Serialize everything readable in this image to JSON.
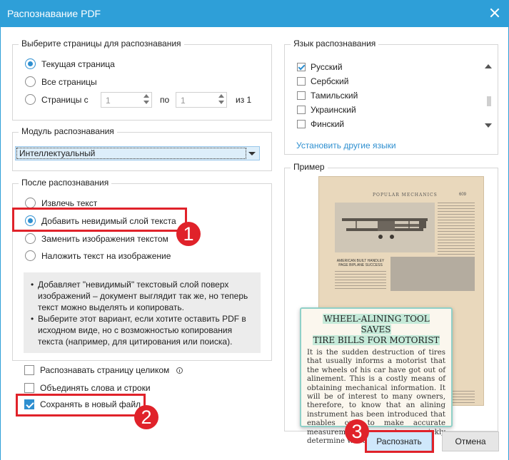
{
  "window": {
    "title": "Распознавание PDF"
  },
  "pages": {
    "legend": "Выберите страницы для распознавания",
    "current_label": "Текущая страница",
    "all_label": "Все страницы",
    "range_label": "Страницы с",
    "from_value": "1",
    "to_label": "по",
    "to_value": "1",
    "of_label": "из 1"
  },
  "module": {
    "legend": "Модуль распознавания",
    "selected": "Интеллектуальный"
  },
  "after": {
    "legend": "После распознавания",
    "options": [
      "Извлечь текст",
      "Добавить невидимый слой текста",
      "Заменить изображения текстом",
      "Наложить текст на изображение"
    ],
    "info": [
      "Добавляет \"невидимый\" текстовый слой поверх изображений – документ выглядит так же, но теперь текст можно выделять и копировать.",
      "Выберите этот вариант, если хотите оставить PDF в исходном виде, но с возможностью копирования текста (например, для цитирования или поиска)."
    ]
  },
  "options": {
    "whole_page": "Распознавать страницу целиком",
    "merge_words": "Объединять слова и строки",
    "save_new": "Сохранять в новый файл"
  },
  "language": {
    "legend": "Язык распознавания",
    "items": [
      {
        "label": "Русский",
        "checked": true
      },
      {
        "label": "Сербский",
        "checked": false
      },
      {
        "label": "Тамильский",
        "checked": false
      },
      {
        "label": "Украинский",
        "checked": false
      },
      {
        "label": "Финский",
        "checked": false
      }
    ],
    "install_link": "Установить другие языки"
  },
  "example": {
    "legend": "Пример",
    "running_head": "POPULAR MECHANICS",
    "page_number": "609",
    "caption": "AMERICAN BUILT HANDLEY PAGE BIPLANE SUCCESS",
    "zoom_head_1": "WHEEL-ALINING TOOL SAVES",
    "zoom_head_2": "TIRE BILLS FOR MOTORIST",
    "zoom_text": "It is the sudden destruction of tires that usually informs a motorist that the wheels of his car have got out of alinement. This is a costly means of obtaining mechanical information. It will be of interest to many owners, therefore, to know that an alining instrument has been introduced that enables one to make accurate measurements and quickly determine whether"
  },
  "buttons": {
    "recognize": "Распознать",
    "cancel": "Отмена"
  },
  "annotations": {
    "badge_1": "1",
    "badge_2": "2",
    "badge_3": "3"
  },
  "colors": {
    "accent": "#2e9fd8",
    "annotation": "#e0222a",
    "highlight": "#c5ead9"
  }
}
